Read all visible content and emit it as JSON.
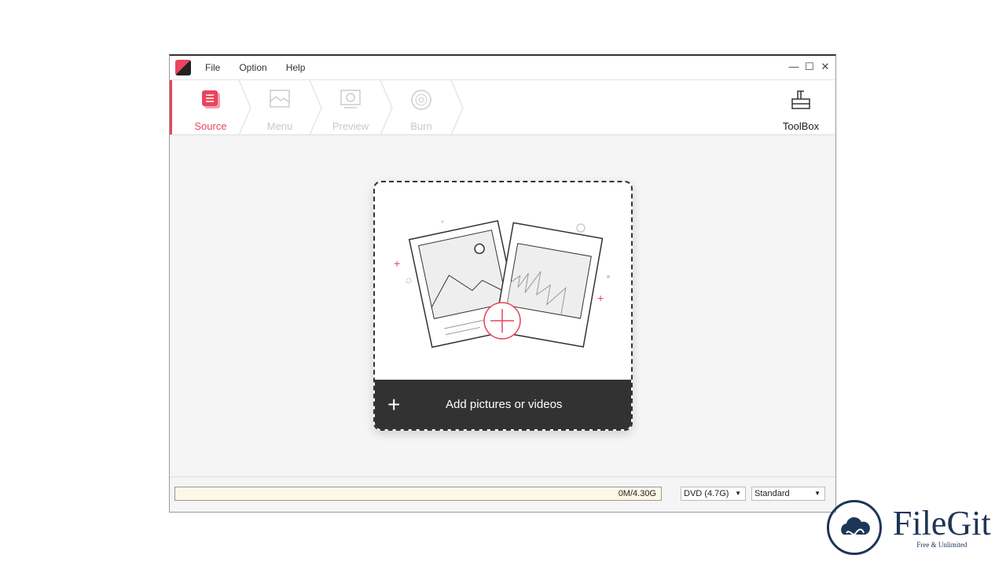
{
  "menu": [
    "File",
    "Option",
    "Help"
  ],
  "window_controls": {
    "minimize": "—",
    "maximize": "☐",
    "close": "✕"
  },
  "steps": [
    {
      "label": "Source",
      "active": true
    },
    {
      "label": "Menu"
    },
    {
      "label": "Preview"
    },
    {
      "label": "Burn"
    }
  ],
  "toolbox": {
    "label": "ToolBox"
  },
  "drop": {
    "add_label": "Add pictures or videos",
    "plus": "+"
  },
  "status": {
    "capacity": "0M/4.30G",
    "progress": 0,
    "disc": "DVD (4.7G)",
    "quality": "Standard"
  },
  "colors": {
    "accent": "#e8455f",
    "dark": "#323232"
  },
  "watermark": {
    "name": "FileGit",
    "tagline": "Free & Unlimited"
  }
}
